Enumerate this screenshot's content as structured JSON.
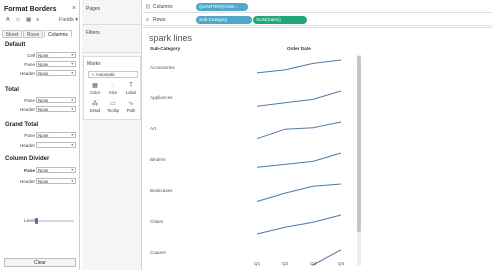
{
  "format_panel": {
    "title": "Format Borders",
    "close": "×",
    "tools": {
      "bold": "A",
      "shading": "◇",
      "borders": "▦",
      "lines": "≡",
      "fields": "Fields ▾"
    },
    "tabs": [
      "Sheet",
      "Rows",
      "Columns"
    ],
    "sections": {
      "default": {
        "title": "Default",
        "rows": [
          {
            "label": "Cell",
            "value": "None"
          },
          {
            "label": "Pane",
            "value": "None"
          },
          {
            "label": "Header",
            "value": "None"
          }
        ]
      },
      "total": {
        "title": "Total",
        "rows": [
          {
            "label": "Pane",
            "value": "None"
          },
          {
            "label": "Header",
            "value": "None"
          }
        ]
      },
      "grand_total": {
        "title": "Grand Total",
        "rows": [
          {
            "label": "Pane",
            "value": "None"
          },
          {
            "label": "Header",
            "value": ""
          }
        ]
      },
      "column_divider": {
        "title": "Column Divider",
        "rows": [
          {
            "label": "Pane",
            "value": "None"
          },
          {
            "label": "Header",
            "value": "None"
          }
        ],
        "level_label": "Level"
      }
    },
    "clear_label": "Clear"
  },
  "cards": {
    "pages": "Pages",
    "filters": "Filters",
    "marks": {
      "title": "Marks",
      "type": "Automatic",
      "buttons": [
        {
          "icon": "▦",
          "label": "Color"
        },
        {
          "icon": "◌",
          "label": "Size"
        },
        {
          "icon": "T",
          "label": "Label"
        },
        {
          "icon": "⁂",
          "label": "Detail"
        },
        {
          "icon": "▭",
          "label": "Tooltip"
        },
        {
          "icon": "∿",
          "label": "Path"
        }
      ]
    }
  },
  "shelves": {
    "columns": {
      "label": "Columns",
      "pill": "QUARTER(Order...",
      "color": "#4fa8c8"
    },
    "rows": {
      "label": "Rows",
      "pills": [
        {
          "text": "Sub-Category",
          "color": "#4fa8c8"
        },
        {
          "text": "SUM(Sales)",
          "color": "#1fa776"
        }
      ]
    }
  },
  "view": {
    "title": "spark lines",
    "row_header": "Sub-Category",
    "col_header": "Order Date",
    "quarters": [
      "Q1",
      "Q2",
      "Q3",
      "Q4"
    ],
    "line_color": "#4e79a7"
  },
  "chart_data": {
    "type": "line",
    "title": "spark lines",
    "xlabel": "Order Date",
    "ylabel": "Sub-Category",
    "categories": [
      "Q1",
      "Q2",
      "Q3",
      "Q4"
    ],
    "series": [
      {
        "name": "Accessories",
        "values": [
          0.32,
          0.48,
          0.82,
          1.0
        ]
      },
      {
        "name": "Appliances",
        "values": [
          0.2,
          0.38,
          0.56,
          1.0
        ]
      },
      {
        "name": "Art",
        "values": [
          0.12,
          0.62,
          0.7,
          1.0
        ]
      },
      {
        "name": "Binders",
        "values": [
          0.25,
          0.4,
          0.56,
          1.0
        ]
      },
      {
        "name": "Bookcases",
        "values": [
          0.08,
          0.52,
          0.88,
          1.0
        ]
      },
      {
        "name": "Chairs",
        "values": [
          0.0,
          0.35,
          0.62,
          1.0
        ]
      },
      {
        "name": "Copiers",
        "values": [
          null,
          null,
          0.0,
          0.8
        ]
      }
    ],
    "grid": false
  }
}
